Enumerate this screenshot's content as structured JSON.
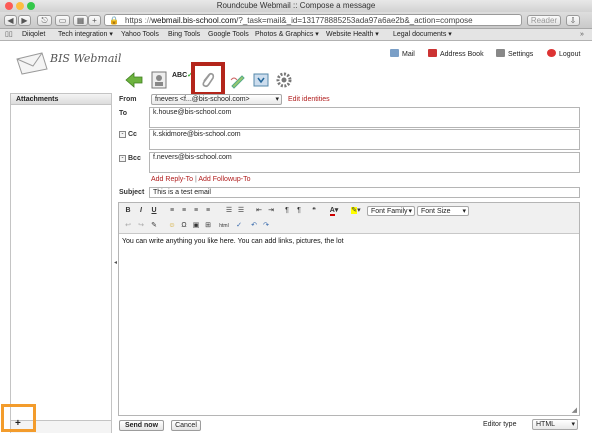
{
  "browser": {
    "window_title": "Roundcube Webmail :: Compose a message",
    "url_scheme": "https",
    "url_host": "webmail.bis-school.com",
    "url_path": "/?_task=mail&_id=131778885253ada97a6ae2b&_action=compose",
    "reader_label": "Reader",
    "bookmarks": [
      "Diiqolet",
      "Tech integration ▾",
      "Yahoo Tools",
      "Bing Tools",
      "Google Tools",
      "Photos & Graphics ▾",
      "Website Health ▾",
      "Legal documents ▾"
    ]
  },
  "header": {
    "logo_text": "BIS Webmail",
    "mail_label": "Mail",
    "addressbook_label": "Address Book",
    "settings_label": "Settings",
    "logout_label": "Logout"
  },
  "compose": {
    "attachments_header": "Attachments",
    "add_button": "+",
    "from_label": "From",
    "from_value": "fnevers <f...@bis-school.com>",
    "edit_identities": "Edit identities",
    "to_label": "To",
    "to_value": "k.house@bis-school.com",
    "cc_label": "Cc",
    "cc_value": "k.skidmore@bis-school.com",
    "bcc_label": "Bcc",
    "bcc_value": "f.nevers@bis-school.com",
    "add_reply_to": "Add Reply-To",
    "separator": "|",
    "add_followup_to": "Add Followup-To",
    "subject_label": "Subject",
    "subject_value": "This is a test email",
    "body_text": "You can write anything you like here. You can add links, pictures, the lot",
    "font_family_label": "Font Family",
    "font_size_label": "Font Size",
    "send_label": "Send now",
    "cancel_label": "Cancel",
    "editor_type_label": "Editor type",
    "editor_type_value": "HTML"
  },
  "editor_toolbar": {
    "row1": [
      "B",
      "I",
      "U",
      "≡",
      "≡",
      "≡",
      "≡",
      "☰",
      "☰",
      "⇤",
      "⇥",
      "¶",
      "¶",
      "❝"
    ],
    "row2": [
      "↩",
      "↪",
      "✎",
      "☺",
      "Ω",
      "▣",
      "⊞",
      "html",
      "✓",
      "↶",
      "↷"
    ]
  },
  "colors": {
    "accent_red": "#b4251b",
    "highlight_orange": "#f39c2c",
    "link_red": "#b01c1c"
  }
}
